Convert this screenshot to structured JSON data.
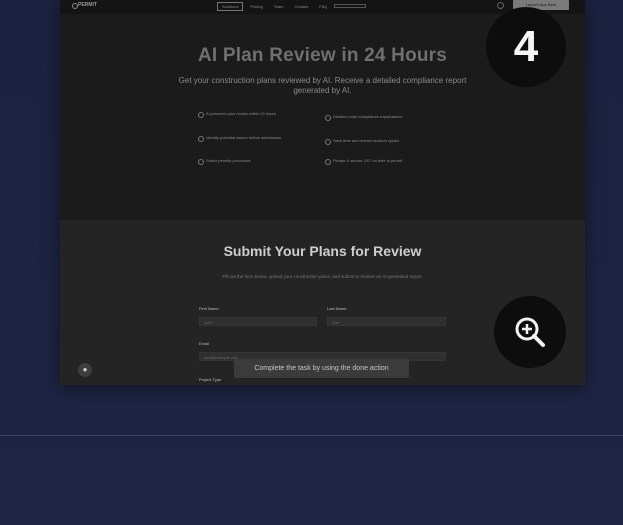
{
  "nav": {
    "logo": "PERMIT",
    "links": [
      "Solutions",
      "Pricing",
      "Team",
      "Contact",
      "FAQ",
      ""
    ],
    "cta_label": "Launch App Beta"
  },
  "hero": {
    "title": "AI Plan Review in 24 Hours",
    "subtitle": "Get your construction plans reviewed by AI. Receive a detailed compliance report generated by AI.",
    "features_left": [
      "AI-powered plan review within 24 hours",
      "Identify potential issues before submission",
      "Select permits processes"
    ],
    "features_right": [
      "Detailed code compliance explanations",
      "Save time and reduce revision cycles",
      "Private & secure 24/7 on time to permit"
    ]
  },
  "submit": {
    "title": "Submit Your Plans for Review",
    "subtitle": "Fill out the form below, upload your construction plans, and submit to receive an AI-generated report.",
    "first_name_label": "First Name",
    "first_name_placeholder": "John",
    "last_name_label": "Last Name",
    "last_name_placeholder": "Doe",
    "email_label": "Email",
    "email_placeholder": "you@example.com",
    "project_type_label": "Project Type"
  },
  "tooltip": "Complete the task by using the done action",
  "overlay": {
    "step_number": "4"
  },
  "colors": {
    "page_background": "#1c2240",
    "card_background": "#1a1a1a",
    "section_background": "#242424",
    "badge_background": "#0d0d0d"
  },
  "icons": [
    "help-icon",
    "zoom-in-icon",
    "settings-icon",
    "logo-icon",
    "check-circle-icon"
  ]
}
